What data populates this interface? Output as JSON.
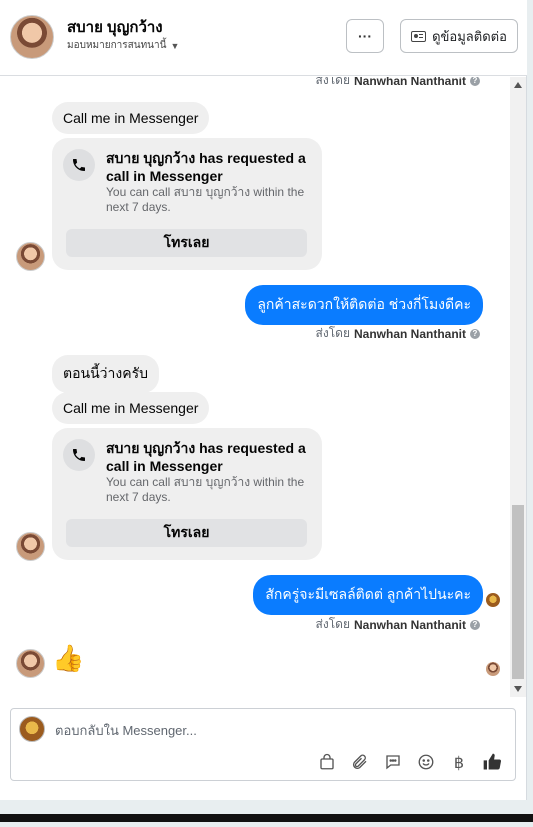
{
  "header": {
    "name": "สบาย บุญกว้าง",
    "assign_label": "มอบหมายการสนทนานี้",
    "more_label": "···",
    "contact_label": "ดูข้อมูลติดต่อ"
  },
  "thread": {
    "sent_by_prefix": "ส่งโดย",
    "sender_name": "Nanwhan Nanthanit",
    "messages": {
      "call_request_1": "Call me in Messenger",
      "card1": {
        "title": "สบาย บุญกว้าง has requested a call in Messenger",
        "subtitle": "You can call สบาย บุญกว้าง within the next 7 days.",
        "button": "โทรเลย"
      },
      "out_1": "ลูกค้าสะดวกให้ติดต่อ ช่วงกี่โมงดีคะ",
      "in_now_free": "ตอนนี้ว่างครับ",
      "call_request_2": "Call me in Messenger",
      "card2": {
        "title": "สบาย บุญกว้าง has requested a call in Messenger",
        "subtitle": "You can call สบาย บุญกว้าง within the next 7 days.",
        "button": "โทรเลย"
      },
      "out_2": "สักครู่จะมีเซลล์ติดต่ ลูกค้าไปนะคะ",
      "thumbs": "👍"
    }
  },
  "composer": {
    "placeholder": "ตอบกลับใน Messenger...",
    "tools": [
      "bag-icon",
      "paperclip-icon",
      "speech-bubble-icon",
      "smiley-icon",
      "baht-icon",
      "thumbs-up-icon"
    ]
  },
  "colors": {
    "accent": "#0a7cff",
    "incoming_bubble": "#efefef"
  }
}
